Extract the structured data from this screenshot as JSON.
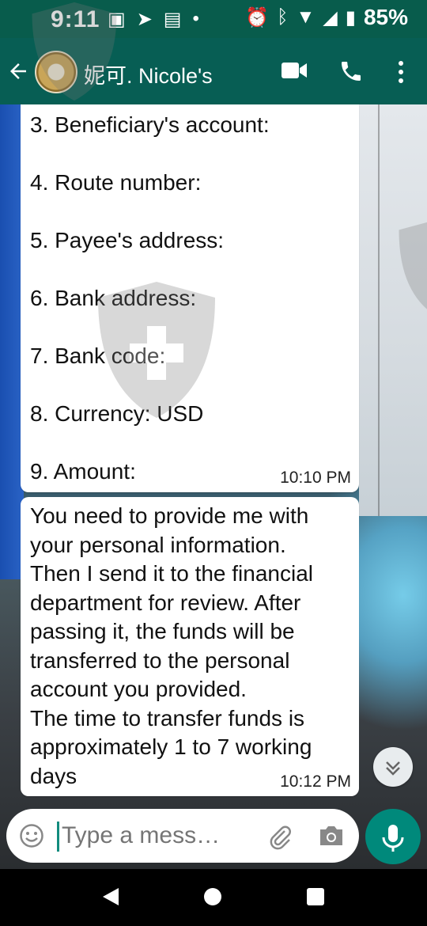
{
  "status_bar": {
    "time": "9:11",
    "battery": "85%",
    "left_icons": [
      "image-icon",
      "telegram-icon",
      "message-icon",
      "dot-icon"
    ],
    "right_icons": [
      "alarm-icon",
      "bluetooth-icon",
      "wifi-icon",
      "signal-icon",
      "battery-icon"
    ]
  },
  "header": {
    "contact_name": "妮可. Nicole's",
    "icons": [
      "back-arrow-icon",
      "video-call-icon",
      "phone-icon",
      "more-vert-icon"
    ]
  },
  "messages": [
    {
      "lines": [
        "3. Beneficiary's account:",
        "4. Route number:",
        "5. Payee's address:",
        "6. Bank address:",
        "7. Bank code:",
        "8. Currency: USD",
        "9. Amount:"
      ],
      "time": "10:10 PM"
    },
    {
      "text": "You need to provide me with\nyour personal information.\nThen I send it to the financial\ndepartment for review. After\npassing it, the funds will be\ntransferred to the personal\naccount you provided.\nThe time to transfer funds is\napproximately 1 to 7 working\ndays",
      "time": "10:12 PM"
    }
  ],
  "composer": {
    "placeholder": "Type a mess…"
  },
  "colors": {
    "header": "#075e54",
    "status_bar": "#085c4c",
    "accent": "#00897b"
  }
}
